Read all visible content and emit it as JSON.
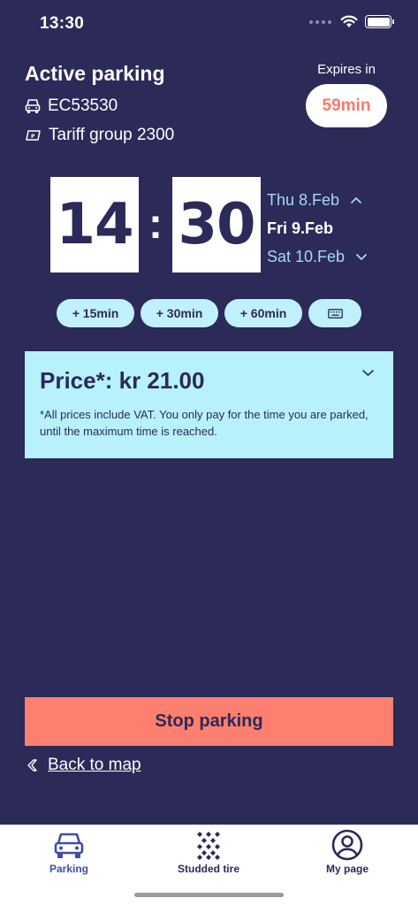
{
  "status_bar": {
    "time": "13:30"
  },
  "header": {
    "title": "Active parking",
    "plate": "EC53530",
    "tariff": "Tariff group 2300",
    "expires_label": "Expires in",
    "expires_value": "59min"
  },
  "time_picker": {
    "hours": "14",
    "minutes": "30",
    "separator": ":",
    "dates": [
      {
        "label": "Thu 8.Feb",
        "selected": false
      },
      {
        "label": "Fri 9.Feb",
        "selected": true
      },
      {
        "label": "Sat 10.Feb",
        "selected": false
      }
    ]
  },
  "quick_add": [
    "+ 15min",
    "+ 30min",
    "+ 60min"
  ],
  "price": {
    "title": "Price*: kr 21.00",
    "note": "*All prices include VAT. You only pay for the time you are parked, until the maximum time is reached."
  },
  "actions": {
    "stop_label": "Stop parking",
    "back_label": "Back to map"
  },
  "tabs": [
    {
      "label": "Parking",
      "active": true
    },
    {
      "label": "Studded tire",
      "active": false
    },
    {
      "label": "My page",
      "active": false
    }
  ],
  "colors": {
    "background": "#2b2a58",
    "accent_coral": "#fc7f6f",
    "panel_cyan": "#b7f1fc",
    "active_tab": "#3c4fa7"
  },
  "icons": [
    "car-icon",
    "ticket-icon",
    "keyboard-icon",
    "chevron-up-icon",
    "chevron-down-icon",
    "back-chevron-icon",
    "studded-tire-icon",
    "user-circle-icon",
    "wifi-icon",
    "battery-icon"
  ]
}
